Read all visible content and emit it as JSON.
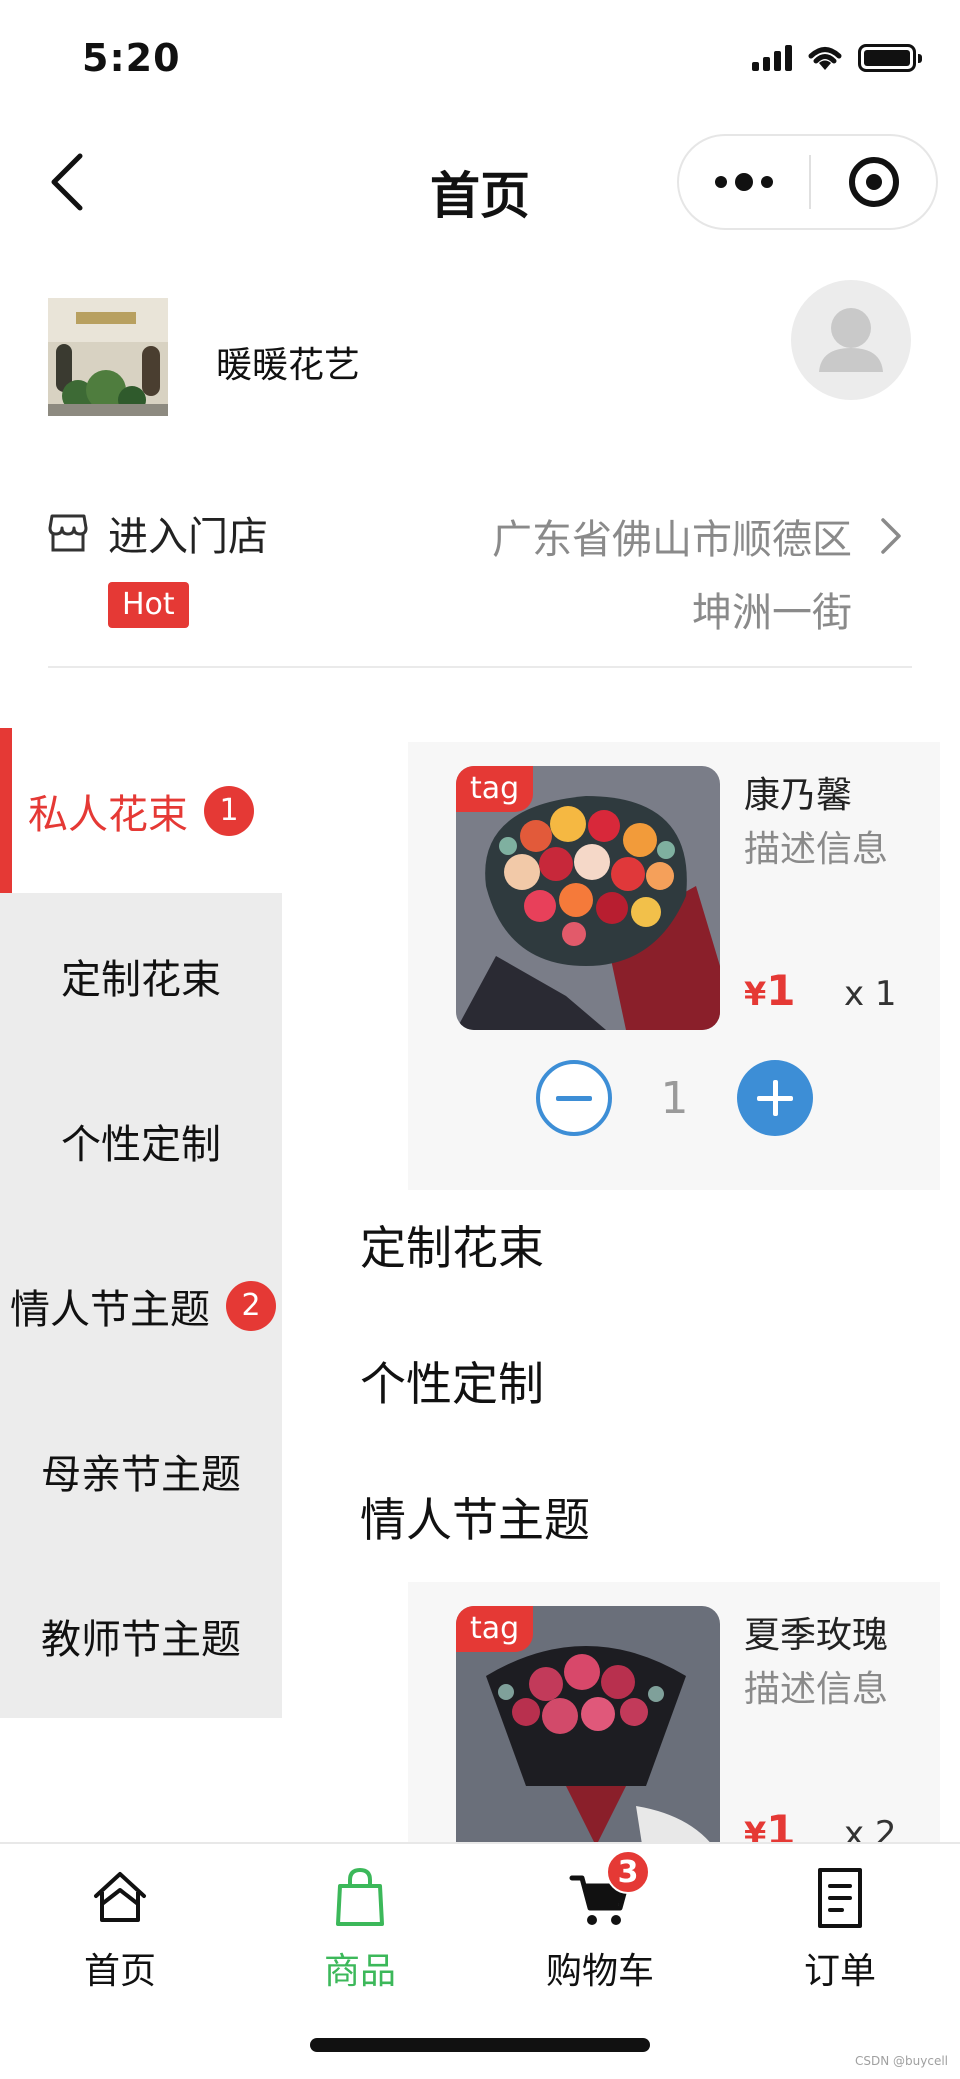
{
  "status_bar": {
    "time": "5:20"
  },
  "nav": {
    "title": "首页"
  },
  "shop": {
    "name": "暖暖花艺"
  },
  "store": {
    "label": "进入门店",
    "hot_badge": "Hot",
    "address": "广东省佛山市顺德区坤洲一街"
  },
  "sidebar": {
    "items": [
      {
        "label": "私人花束",
        "badge": "1",
        "active": true
      },
      {
        "label": "定制花束"
      },
      {
        "label": "个性定制"
      },
      {
        "label": "情人节主题",
        "badge": "2"
      },
      {
        "label": "母亲节主题"
      },
      {
        "label": "教师节主题"
      }
    ]
  },
  "products": [
    {
      "tag": "tag",
      "name": "康乃馨",
      "desc": "描述信息",
      "price_symbol": "¥",
      "price": "1",
      "qty_label": "x 1",
      "stepper_value": "1"
    },
    {
      "tag": "tag",
      "name": "夏季玫瑰",
      "desc": "描述信息",
      "price_symbol": "¥",
      "price": "1",
      "qty_label": "x 2"
    }
  ],
  "sections": [
    "定制花束",
    "个性定制",
    "情人节主题"
  ],
  "tab_bar": {
    "items": [
      {
        "label": "首页",
        "icon": "home-icon"
      },
      {
        "label": "商品",
        "icon": "shopping-bag-icon",
        "active": true
      },
      {
        "label": "购物车",
        "icon": "cart-icon",
        "badge": "3"
      },
      {
        "label": "订单",
        "icon": "order-icon"
      }
    ]
  },
  "watermark": "CSDN @buycell",
  "colors": {
    "accent_red": "#e53935",
    "stepper_blue": "#3d8ed6",
    "tab_active_green": "#3cb85a"
  }
}
